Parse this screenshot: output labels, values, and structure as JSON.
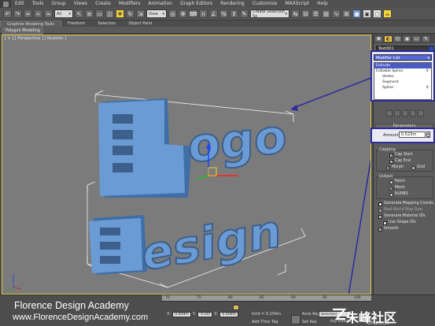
{
  "menu": [
    "Edit",
    "Tools",
    "Group",
    "Views",
    "Create",
    "Modifiers",
    "Animation",
    "Graph Editors",
    "Rendering",
    "Customize",
    "MAXScript",
    "Help"
  ],
  "toolbar": {
    "selection_filter": "All",
    "ref_coord": "View",
    "named_selection": "Create Selection Se"
  },
  "ribbon": {
    "tabs": [
      "Graphite Modeling Tools",
      "Freeform",
      "Selection",
      "Object Paint"
    ],
    "sub_label": "Polygon Modeling"
  },
  "viewport": {
    "label": "[ + ] [ Perspective ] [ Realistic ]",
    "logo_word": "Logo",
    "design_word": "Design"
  },
  "command_panel": {
    "object_name": "Text001",
    "modifier_list": "Modifier List",
    "stack": [
      {
        "label": "Extrude",
        "selected": true
      },
      {
        "label": "Editable Spline",
        "selected": false
      },
      {
        "label": "Vertex",
        "selected": false
      },
      {
        "label": "Segment",
        "selected": false
      },
      {
        "label": "Spline",
        "selected": false
      }
    ],
    "parameters_title": "Parameters",
    "amount_label": "Amount:",
    "amount_value": "0.523m",
    "capping_title": "Capping",
    "cap_start": "Cap Start",
    "cap_end": "Cap End",
    "morph": "Morph",
    "grid": "Grid",
    "output_title": "Output",
    "patch": "Patch",
    "mesh": "Mesh",
    "nurbs": "NURBS",
    "gen_mapping": "Generate Mapping Coords.",
    "real_world": "Real-World Map Size",
    "gen_matids": "Generate Material IDs",
    "use_shape_ids": "Use Shape IDs",
    "smooth": "Smooth"
  },
  "status": {
    "brand_line1": "Florence Design Academy",
    "brand_line2": "www.FlorenceDesignAcademy.com",
    "ticks": [
      "70",
      "75",
      "80",
      "85",
      "90",
      "95",
      "100"
    ],
    "x_label": "X:",
    "x_value": "0.009m",
    "y_label": "Y:",
    "y_value": "-0.0m",
    "z_label": "Z:",
    "z_value": "0.009m",
    "grid": "Grid = 0.254m",
    "add_time_tag": "Add Time Tag",
    "auto_key": "Auto Key",
    "set_key": "Set Key",
    "selected": "Selected",
    "key_filters": "Key Filters...",
    "watermark_cn": "朱峰社区",
    "watermark_url": "ZF3D.COM"
  }
}
